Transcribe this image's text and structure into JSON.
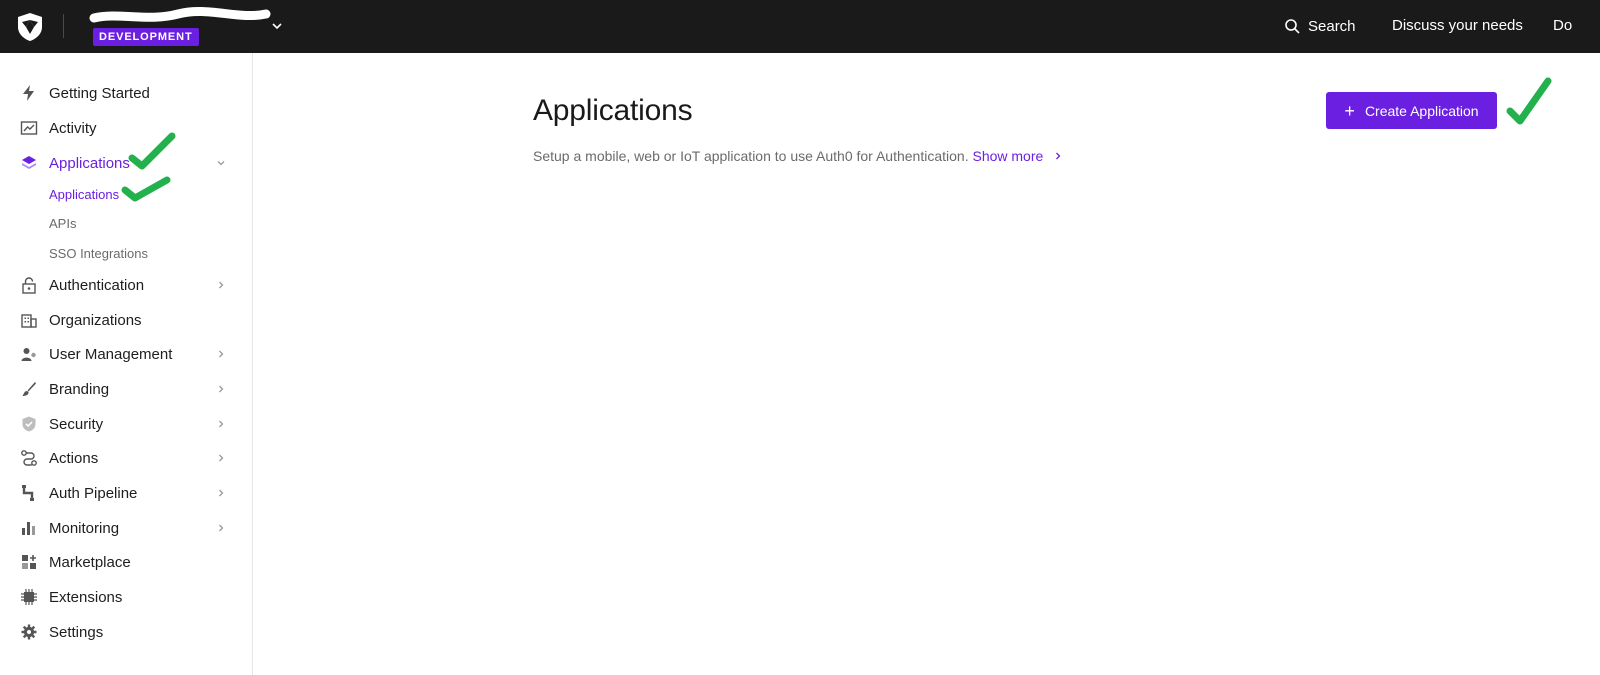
{
  "header": {
    "environment_badge": "DEVELOPMENT",
    "search_label": "Search",
    "discuss_label": "Discuss your needs",
    "truncated_label": "Do"
  },
  "sidebar": {
    "items": [
      {
        "label": "Getting Started",
        "icon": "lightning-icon"
      },
      {
        "label": "Activity",
        "icon": "chart-trend-icon"
      },
      {
        "label": "Applications",
        "icon": "layers-icon"
      },
      {
        "label": "Authentication",
        "icon": "lock-icon"
      },
      {
        "label": "Organizations",
        "icon": "building-icon"
      },
      {
        "label": "User Management",
        "icon": "users-icon"
      },
      {
        "label": "Branding",
        "icon": "brush-icon"
      },
      {
        "label": "Security",
        "icon": "shield-icon"
      },
      {
        "label": "Actions",
        "icon": "flow-icon"
      },
      {
        "label": "Auth Pipeline",
        "icon": "pipeline-icon"
      },
      {
        "label": "Monitoring",
        "icon": "bar-chart-icon"
      },
      {
        "label": "Marketplace",
        "icon": "grid-plus-icon"
      },
      {
        "label": "Extensions",
        "icon": "chip-icon"
      },
      {
        "label": "Settings",
        "icon": "gear-icon"
      }
    ],
    "applications_subitems": [
      {
        "label": "Applications"
      },
      {
        "label": "APIs"
      },
      {
        "label": "SSO Integrations"
      }
    ]
  },
  "main": {
    "title": "Applications",
    "description": "Setup a mobile, web or IoT application to use Auth0 for Authentication.",
    "show_more": "Show more",
    "create_button": "Create Application"
  },
  "colors": {
    "accent": "#6b1fe0",
    "topbar": "#1a1a1a",
    "annotation": "#22b14c"
  }
}
